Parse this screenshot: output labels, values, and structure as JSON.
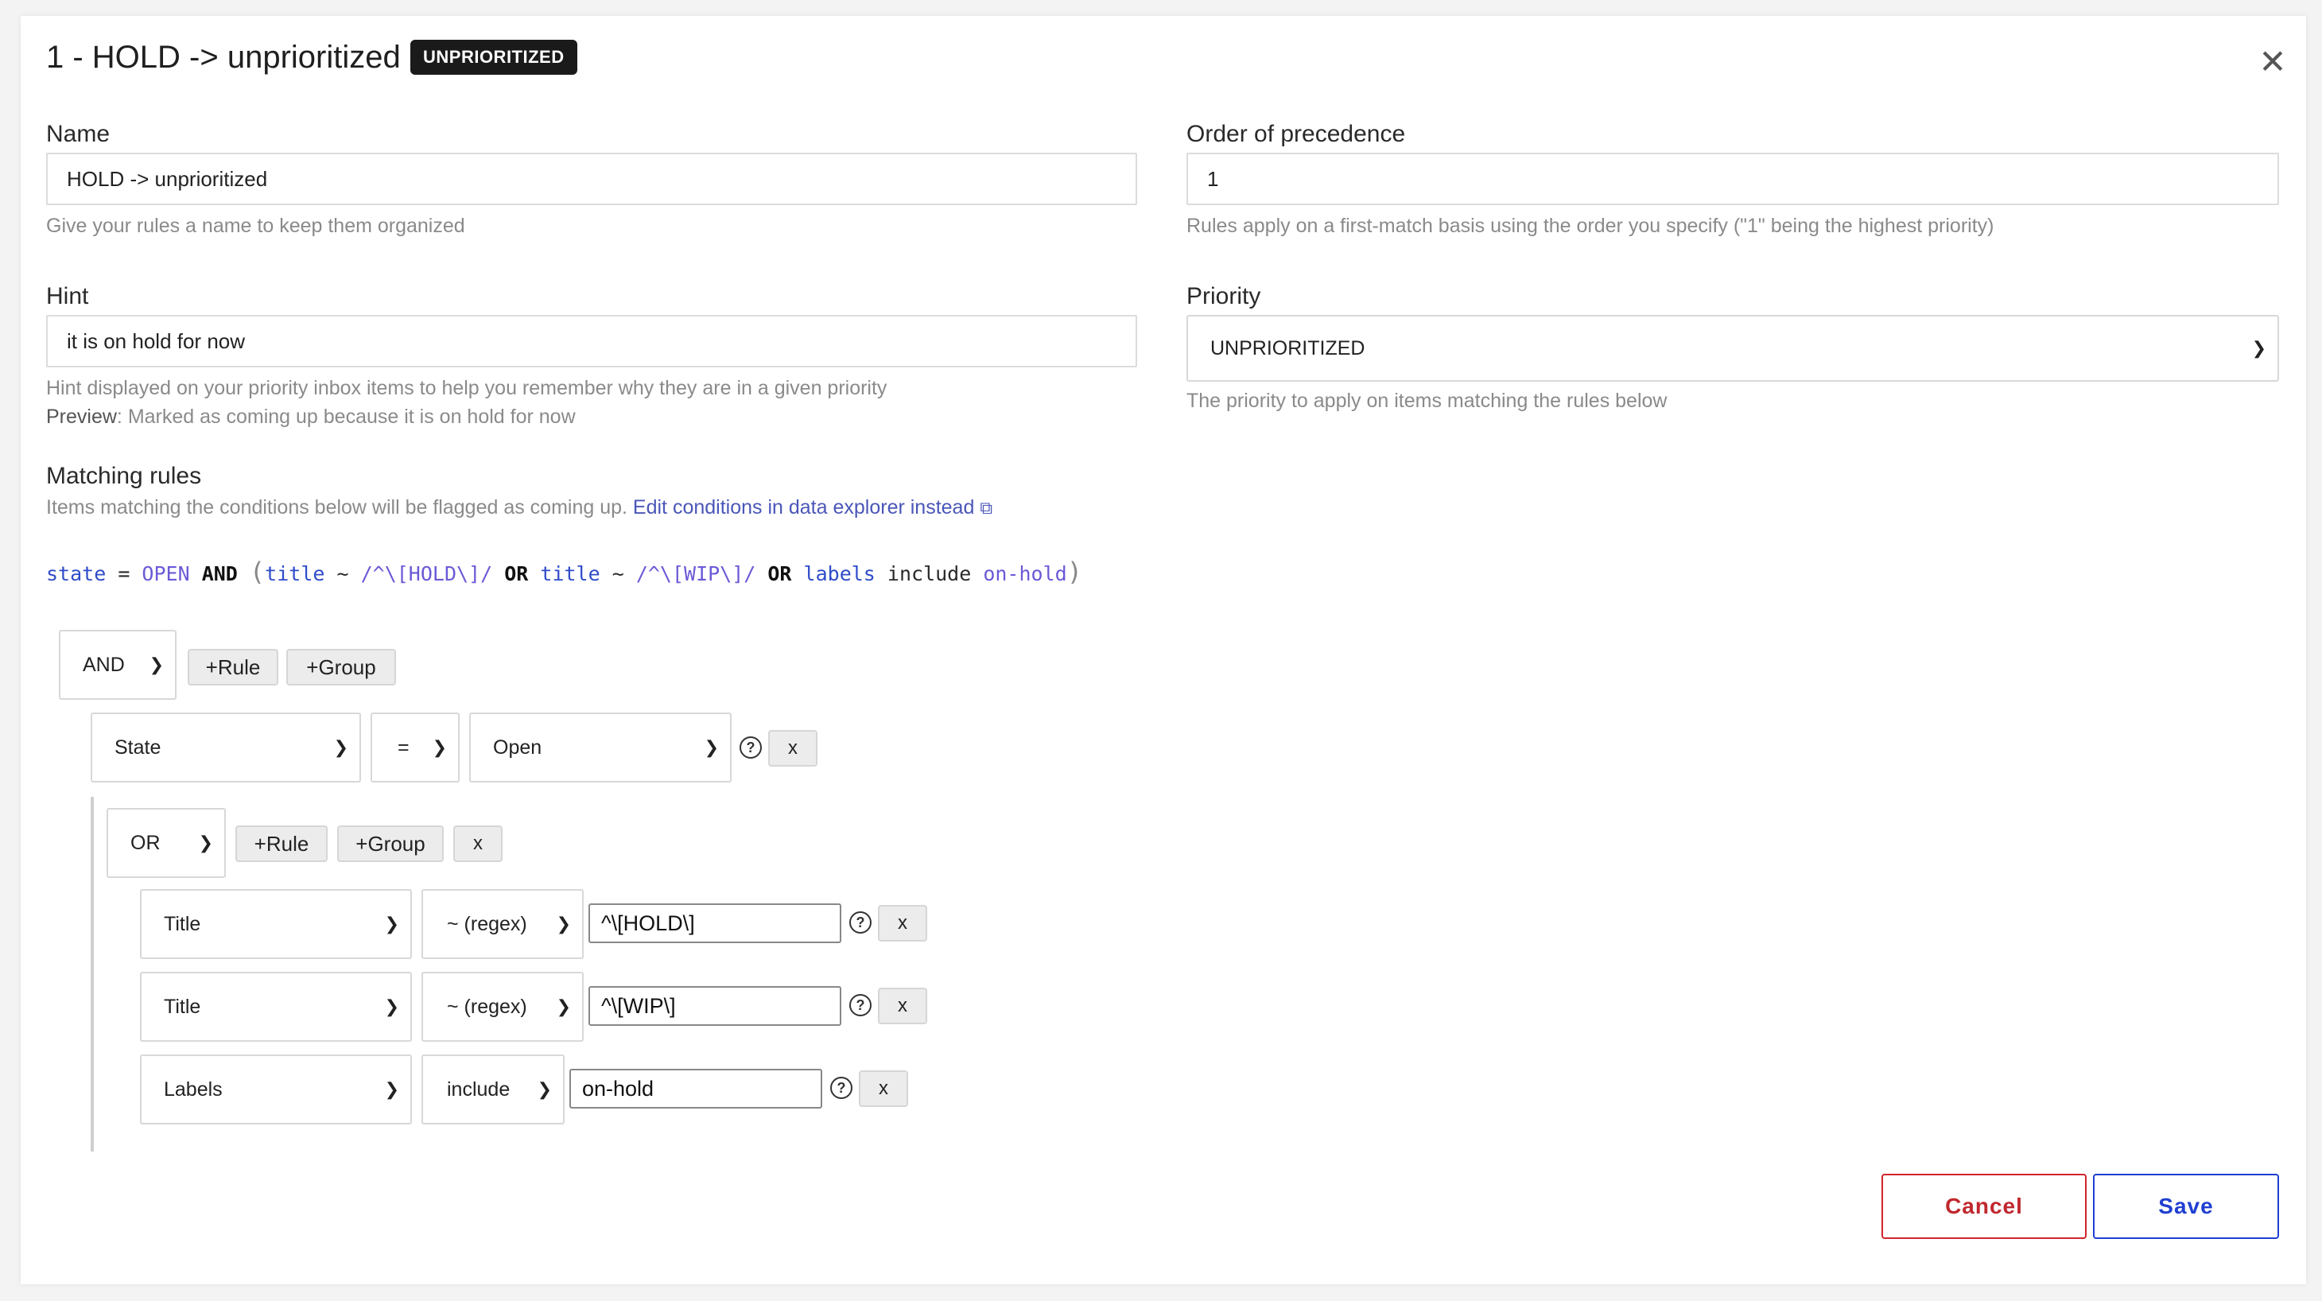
{
  "modal": {
    "title": "1 - HOLD -> unprioritized",
    "badge": "UNPRIORITIZED",
    "close_glyph": "✕"
  },
  "name": {
    "label": "Name",
    "value": "HOLD -> unprioritized",
    "help": "Give your rules a name to keep them organized"
  },
  "order": {
    "label": "Order of precedence",
    "value": "1",
    "help": "Rules apply on a first-match basis using the order you specify (\"1\" being the highest priority)"
  },
  "hint": {
    "label": "Hint",
    "value": "it is on hold for now",
    "help": "Hint displayed on your priority inbox items to help you remember why they are in a given priority",
    "preview_label": "Preview",
    "preview_text": ": Marked as coming up because it is on hold for now"
  },
  "priority": {
    "label": "Priority",
    "value": "UNPRIORITIZED",
    "help": "The priority to apply on items matching the rules below"
  },
  "matching": {
    "label": "Matching rules",
    "help": "Items matching the conditions below will be flagged as coming up.",
    "link": "Edit conditions in data explorer instead",
    "expression": {
      "f1": "state",
      "eq": " = ",
      "v1": "OPEN",
      "and": " AND ",
      "lp": "(",
      "f2": "title",
      "re1": " ~ ",
      "v2": "/^\\[HOLD\\]/",
      "or1": " OR ",
      "f3": "title",
      "re2": " ~ ",
      "v3": "/^\\[WIP\\]/",
      "or2": " OR ",
      "f4": "labels",
      "inc": " include ",
      "v4": "on-hold",
      "rp": ")"
    }
  },
  "builder": {
    "root_op": "AND",
    "add_rule": "+Rule",
    "add_group": "+Group",
    "rule1": {
      "field": "State",
      "operator": "=",
      "value": "Open"
    },
    "group": {
      "op": "OR",
      "add_rule": "+Rule",
      "add_group": "+Group",
      "rules": [
        {
          "field": "Title",
          "operator": "~ (regex)",
          "value": "^\\[HOLD\\]"
        },
        {
          "field": "Title",
          "operator": "~ (regex)",
          "value": "^\\[WIP\\]"
        },
        {
          "field": "Labels",
          "operator": "include",
          "value": "on-hold"
        }
      ]
    },
    "remove_label": "x",
    "help_glyph": "?"
  },
  "footer": {
    "cancel": "Cancel",
    "save": "Save"
  },
  "colors": {
    "cancel": "#c0282e",
    "save": "#1f3fd1",
    "link": "#4a56b8",
    "badge_bg": "#1a1a1a"
  }
}
